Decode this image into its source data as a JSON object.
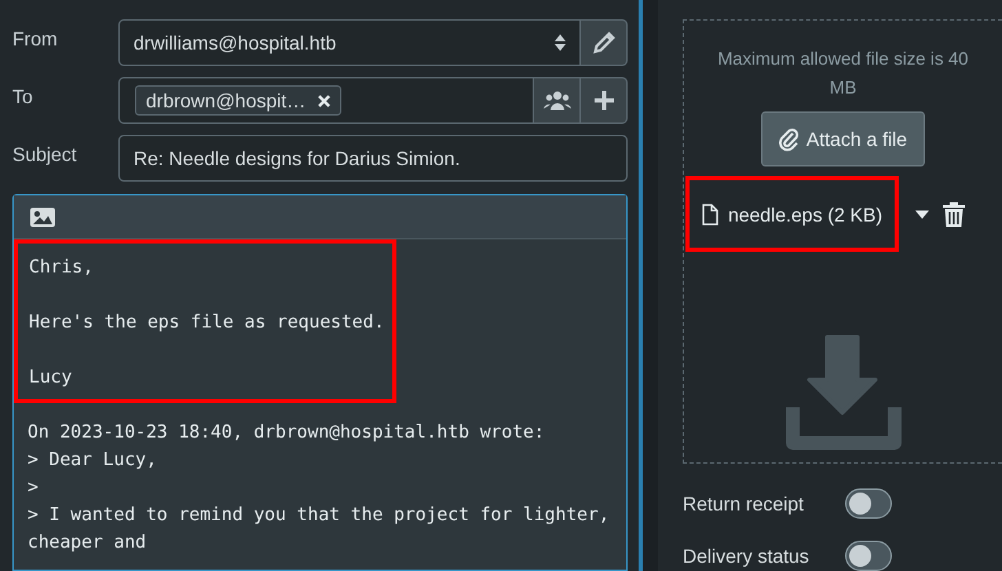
{
  "compose": {
    "from": {
      "label": "From",
      "value": "drwilliams@hospital.htb"
    },
    "to": {
      "label": "To",
      "recipients": [
        "drbrown@hospit…"
      ]
    },
    "subject": {
      "label": "Subject",
      "value": "Re: Needle designs for Darius Simion."
    },
    "body": {
      "reply_paragraphs": [
        "Chris,",
        "Here's the eps file as requested.",
        "Lucy"
      ],
      "quoted_lines": [
        "On 2023-10-23 18:40, drbrown@hospital.htb wrote:",
        "> Dear Lucy,",
        ">",
        "> I wanted to remind you that the project for lighter, cheaper and"
      ]
    }
  },
  "attachments": {
    "hint": "Maximum allowed file size is 40 MB",
    "button": "Attach a file",
    "files": [
      {
        "name": "needle.eps (2 KB)"
      }
    ]
  },
  "options": [
    {
      "label": "Return receipt",
      "on": false
    },
    {
      "label": "Delivery status",
      "on": false
    }
  ]
}
